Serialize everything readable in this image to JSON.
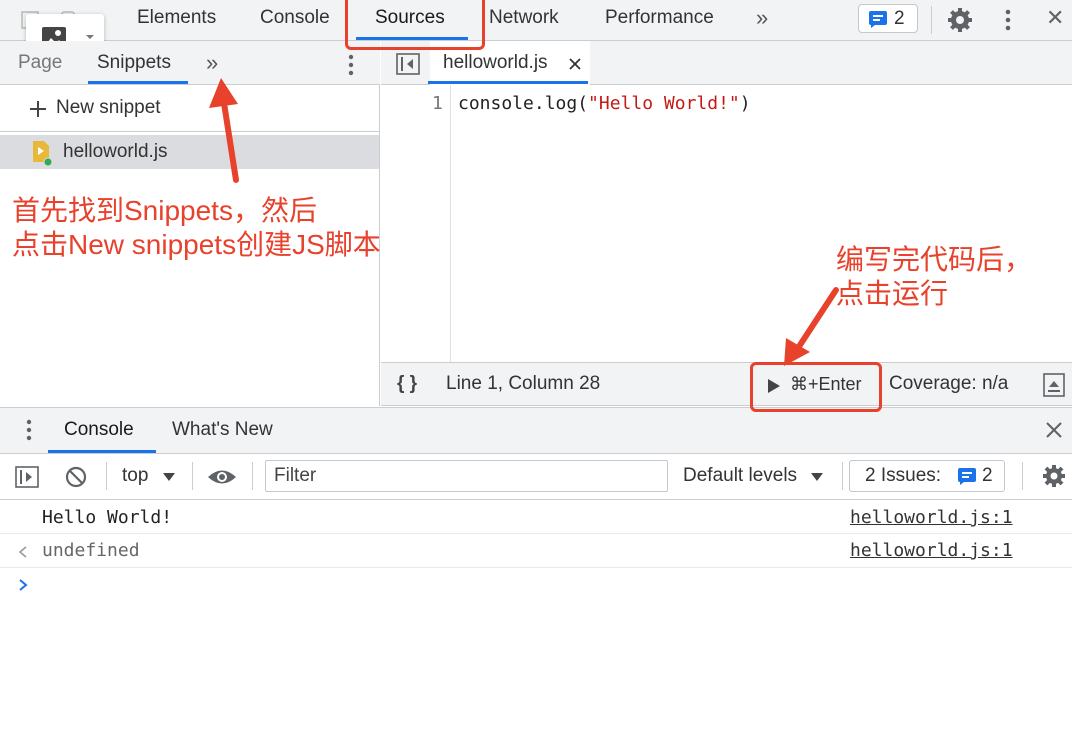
{
  "toolbar": {
    "tabs": [
      "Elements",
      "Console",
      "Sources",
      "Network",
      "Performance"
    ],
    "more": "»",
    "issues_count": "2",
    "close": "✕"
  },
  "navigator": {
    "tabs": [
      "Page",
      "Snippets"
    ],
    "more": "»",
    "new_snippet": "New snippet",
    "file": "helloworld.js"
  },
  "editor": {
    "tab_name": "helloworld.js",
    "line_number": "1",
    "code_prefix": "console.log(",
    "code_string": "\"Hello World!\"",
    "code_suffix": ")"
  },
  "status_bar": {
    "braces": "{ }",
    "position": "Line 1, Column 28",
    "run_shortcut": "⌘+Enter",
    "coverage": "Coverage: n/a"
  },
  "drawer": {
    "tabs": [
      "Console",
      "What's New"
    ],
    "context": "top",
    "filter_placeholder": "Filter",
    "levels": "Default levels",
    "issues_label": "2 Issues:",
    "issues_count": "2"
  },
  "console_rows": [
    {
      "text": "Hello World!",
      "source": "helloworld.js:1"
    },
    {
      "text": "undefined",
      "source": "helloworld.js:1"
    }
  ],
  "annotations": {
    "left_line1": "首先找到Snippets，然后",
    "left_line2": "点击New snippets创建JS脚本",
    "right_line1": "编写完代码后，",
    "right_line2": "点击运行"
  },
  "colors": {
    "accent": "#1a73e8",
    "annotation": "#e8412c",
    "code_string": "#c41a16"
  }
}
